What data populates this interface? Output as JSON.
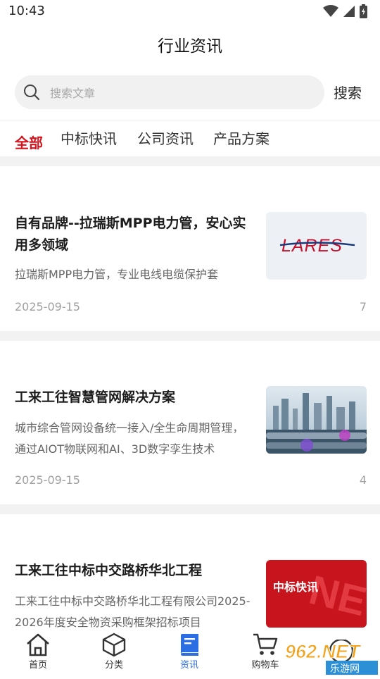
{
  "status": {
    "time": "10:43"
  },
  "header": {
    "title": "行业资讯"
  },
  "search": {
    "placeholder": "搜索文章",
    "value": "",
    "button_label": "搜索"
  },
  "tabs": [
    {
      "label": "全部",
      "active": true
    },
    {
      "label": "中标快讯",
      "active": false
    },
    {
      "label": "公司资讯",
      "active": false
    },
    {
      "label": "产品方案",
      "active": false
    }
  ],
  "articles": [
    {
      "title": "自有品牌--拉瑞斯MPP电力管，安心实用多领域",
      "summary": "拉瑞斯MPP电力管，专业电线电缆保护套",
      "date": "2025-09-15",
      "count": "7",
      "thumb_text": "LARES",
      "thumb_color": "#c8102e"
    },
    {
      "title": "工来工往智慧管网解决方案",
      "summary": "城市综合管网设备统一接入/全生命周期管理，通过AIOT物联网和AI、3D数字孪生技术",
      "date": "2025-09-15",
      "count": "4",
      "thumb_text": "",
      "thumb_color": "#4a7fa8"
    },
    {
      "title": "工来工往中标中交路桥华北工程",
      "summary": "工来工往中标中交路桥华北工程有限公司2025-2026年度安全物资采购框架招标项目",
      "date": "",
      "count": "",
      "thumb_text": "中标快讯",
      "thumb_color": "#c8141c"
    }
  ],
  "bottom_nav": [
    {
      "label": "首页",
      "icon": "home-icon",
      "active": false
    },
    {
      "label": "分类",
      "icon": "cube-icon",
      "active": false
    },
    {
      "label": "资讯",
      "icon": "book-icon",
      "active": true
    },
    {
      "label": "购物车",
      "icon": "cart-icon",
      "active": false
    }
  ],
  "watermark": {
    "text": "962.NET",
    "subtext": "乐游网"
  },
  "colors": {
    "accent_red": "#d6121b",
    "nav_active_blue": "#2b6de2",
    "divider_gray": "#f2f2f2"
  }
}
